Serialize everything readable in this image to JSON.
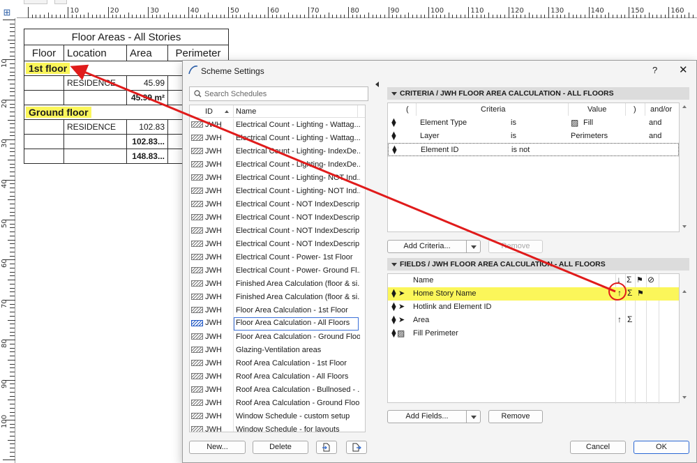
{
  "schedule": {
    "title": "Floor Areas - All Stories",
    "headers": [
      "Floor",
      "Location",
      "Area",
      "Perimeter"
    ],
    "story1": {
      "label": "1st floor",
      "location": "RESIDENCE",
      "area": "45.99",
      "subtotal": "45.99 m²"
    },
    "story2": {
      "label": "Ground floor",
      "location": "RESIDENCE",
      "area": "102.83",
      "subtotal": "102.83..."
    },
    "total": "148.83..."
  },
  "ruler": {
    "top_labels": [
      "10",
      "20",
      "30",
      "40",
      "50",
      "60",
      "70",
      "80",
      "90",
      "100",
      "110",
      "120",
      "130",
      "140",
      "150",
      "160"
    ],
    "left_labels": [
      "10",
      "20",
      "30",
      "40",
      "50",
      "60",
      "70",
      "80",
      "90",
      "100"
    ]
  },
  "dialog": {
    "title": "Scheme Settings",
    "help": "?",
    "close": "✕",
    "search_placeholder": "Search Schedules",
    "list_headers": {
      "id": "ID",
      "name": "Name"
    },
    "schedules": [
      {
        "id": "JWH",
        "name": "Electrical Count - Lighting - Wattag..."
      },
      {
        "id": "JWH",
        "name": "Electrical Count - Lighting - Wattag..."
      },
      {
        "id": "JWH",
        "name": "Electrical Count - Lighting- IndexDe..."
      },
      {
        "id": "JWH",
        "name": "Electrical Count - Lighting- IndexDe..."
      },
      {
        "id": "JWH",
        "name": "Electrical Count - Lighting- NOT Ind..."
      },
      {
        "id": "JWH",
        "name": "Electrical Count - Lighting- NOT Ind..."
      },
      {
        "id": "JWH",
        "name": "Electrical Count - NOT IndexDescrip..."
      },
      {
        "id": "JWH",
        "name": "Electrical Count - NOT IndexDescrip..."
      },
      {
        "id": "JWH",
        "name": "Electrical Count - NOT IndexDescrip..."
      },
      {
        "id": "JWH",
        "name": "Electrical Count - NOT IndexDescrip..."
      },
      {
        "id": "JWH",
        "name": "Electrical Count - Power- 1st Floor"
      },
      {
        "id": "JWH",
        "name": "Electrical Count - Power- Ground Fl..."
      },
      {
        "id": "JWH",
        "name": "Finished Area Calculation (floor & si..."
      },
      {
        "id": "JWH",
        "name": "Finished Area Calculation (floor & si..."
      },
      {
        "id": "JWH",
        "name": "Floor Area Calculation - 1st Floor"
      },
      {
        "id": "JWH",
        "name": "Floor Area Calculation - All Floors"
      },
      {
        "id": "JWH",
        "name": "Floor Area Calculation - Ground Floor"
      },
      {
        "id": "JWH",
        "name": "Glazing-Ventilation areas"
      },
      {
        "id": "JWH",
        "name": "Roof Area Calculation - 1st Floor"
      },
      {
        "id": "JWH",
        "name": "Roof Area Calculation - All Floors"
      },
      {
        "id": "JWH",
        "name": "Roof Area Calculation - Bullnosed - ..."
      },
      {
        "id": "JWH",
        "name": "Roof Area Calculation - Ground Floor"
      },
      {
        "id": "JWH",
        "name": "Window Schedule - custom setup"
      },
      {
        "id": "JWH",
        "name": "Window Schedule - for layouts"
      }
    ],
    "selected_index": 15,
    "buttons": {
      "new": "New...",
      "delete": "Delete",
      "cancel": "Cancel",
      "ok": "OK"
    },
    "criteria": {
      "header": "CRITERIA / JWH FLOOR AREA CALCULATION - ALL FLOORS",
      "columns": {
        "open": "(",
        "criteria": "Criteria",
        "value": "Value",
        "close": ")",
        "andor": "and/or"
      },
      "rows": [
        {
          "criteria": "Element Type",
          "op": "is",
          "value": "Fill",
          "andor": "and"
        },
        {
          "criteria": "Layer",
          "op": "is",
          "value": "Perimeters",
          "andor": "and"
        },
        {
          "criteria": "Element ID",
          "op": "is not",
          "value": "",
          "andor": ""
        }
      ],
      "add_label": "Add Criteria...",
      "remove_label": "Remove"
    },
    "fields": {
      "header": "FIELDS / JWH FLOOR AREA CALCULATION - ALL FLOORS",
      "name_col": "Name",
      "rows": [
        {
          "name": "Home Story Name",
          "sort": "↑",
          "sum": "Σ",
          "highlighted": true
        },
        {
          "name": "Hotlink and Element ID",
          "sort": "",
          "sum": "",
          "highlighted": false
        },
        {
          "name": "Area",
          "sort": "↑",
          "sum": "Σ",
          "highlighted": false
        },
        {
          "name": "Fill Perimeter",
          "sort": "",
          "sum": "",
          "highlighted": false
        }
      ],
      "add_label": "Add Fields...",
      "remove_label": "Remove"
    }
  },
  "colors": {
    "highlight": "#fbf65a",
    "annotation": "#e01b1b",
    "accent": "#2a67d3"
  }
}
